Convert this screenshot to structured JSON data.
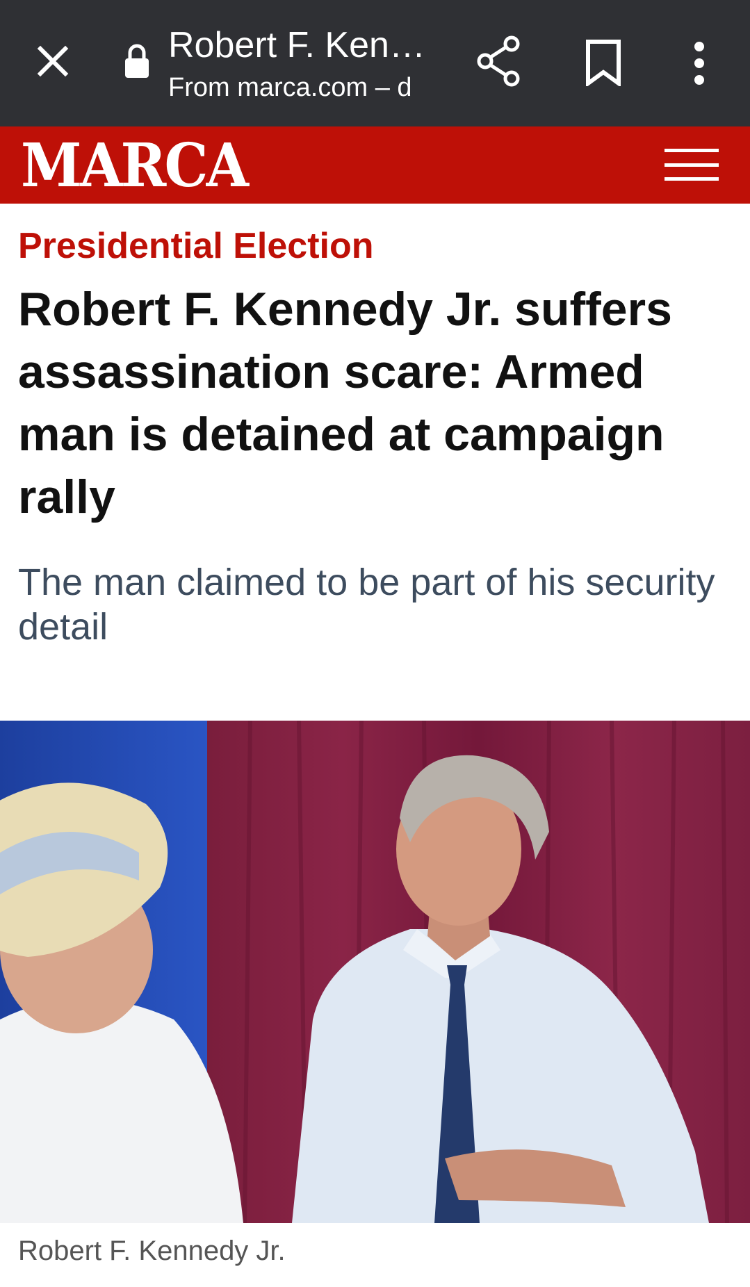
{
  "browser_bar": {
    "page_title": "Robert F. Ken…",
    "page_source": "From marca.com – d",
    "icons": {
      "close": "close-icon",
      "lock": "lock-icon",
      "share": "share-icon",
      "bookmark": "bookmark-icon",
      "more": "more-vert-icon"
    }
  },
  "site_header": {
    "logo_text": "MARCA",
    "brand_color": "#be1007",
    "menu_icon": "hamburger-icon"
  },
  "article": {
    "section": "Presidential Election",
    "headline": "Robert F. Kennedy Jr. suffers assassination scare: Armed man is detained at campaign rally",
    "subtitle": "The man claimed to be part of his security detail",
    "image_caption": "Robert F. Kennedy Jr."
  }
}
